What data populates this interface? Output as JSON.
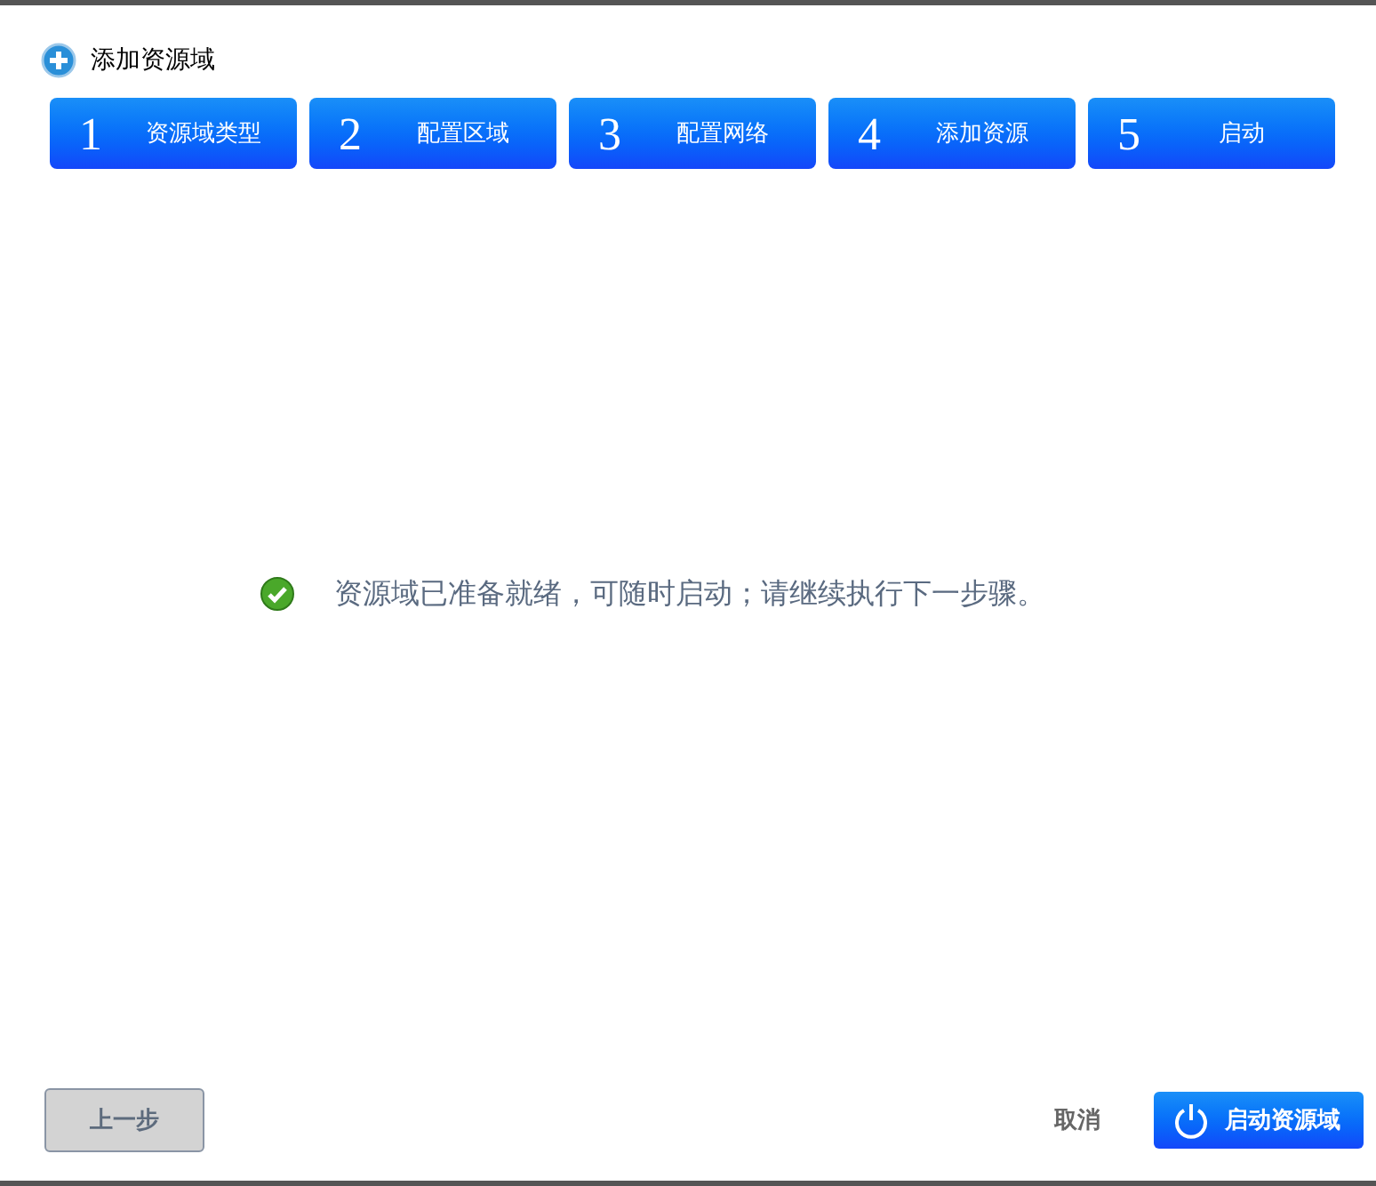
{
  "title": "添加资源域",
  "steps": [
    {
      "number": "1",
      "label": "资源域类型"
    },
    {
      "number": "2",
      "label": "配置区域"
    },
    {
      "number": "3",
      "label": "配置网络"
    },
    {
      "number": "4",
      "label": "添加资源"
    },
    {
      "number": "5",
      "label": "启动"
    }
  ],
  "message": "资源域已准备就绪，可随时启动；请继续执行下一步骤。",
  "buttons": {
    "back": "上一步",
    "cancel": "取消",
    "start": "启动资源域"
  }
}
